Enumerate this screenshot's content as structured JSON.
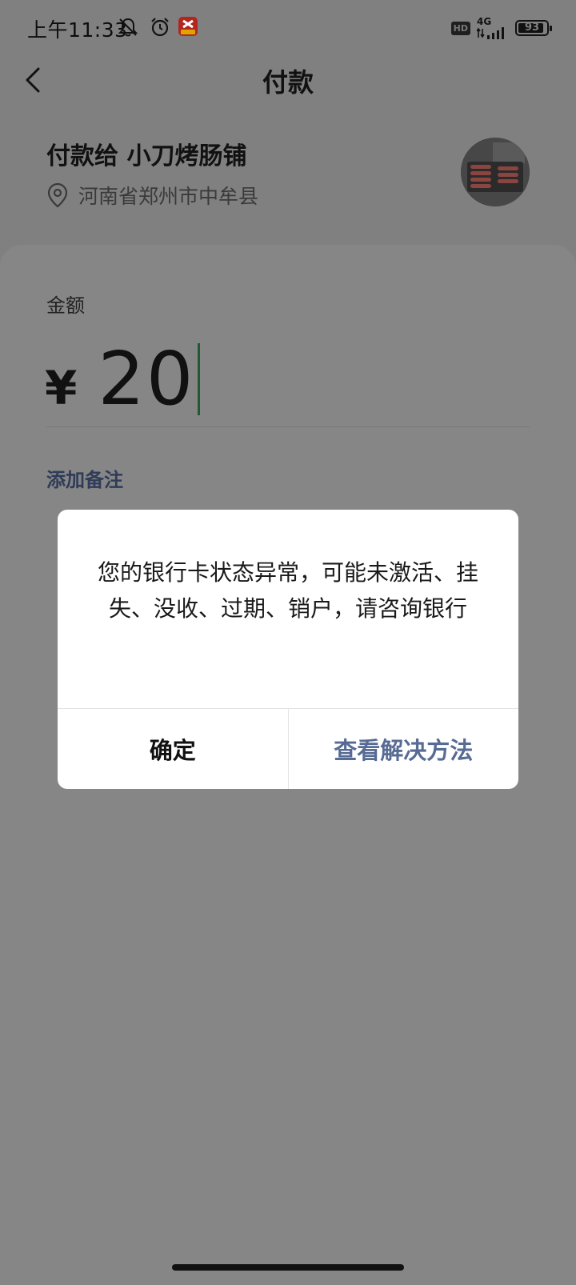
{
  "status_bar": {
    "time": "上午11:33",
    "icons": [
      "bell-off-icon",
      "alarm-icon",
      "app-notification-icon"
    ],
    "hd_label": "HD",
    "network_label": "4G",
    "battery_level": "93"
  },
  "nav": {
    "title": "付款",
    "back_icon": "chevron-left-icon"
  },
  "merchant": {
    "payee_line": "付款给 小刀烤肠铺",
    "address": "河南省郑州市中牟县"
  },
  "payment": {
    "amount_label": "金额",
    "currency": "¥",
    "amount": "20",
    "remark_link": "添加备注"
  },
  "dialog": {
    "message": "您的银行卡状态异常，可能未激活、挂失、没收、过期、销户，请咨询银行",
    "confirm_label": "确定",
    "solution_label": "查看解决方法"
  },
  "colors": {
    "overlay_bg": "#808080",
    "dialog_bg": "#ffffff",
    "link_color": "#576b95",
    "cursor_color": "#1f5a33"
  }
}
